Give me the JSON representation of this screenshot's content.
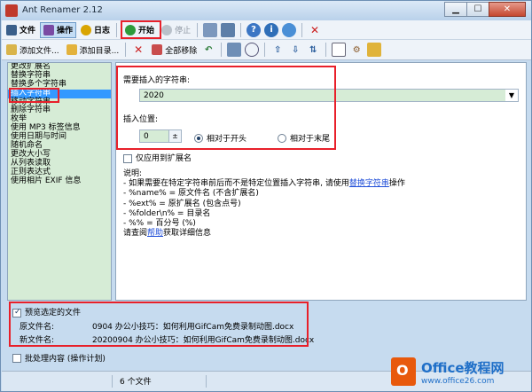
{
  "window": {
    "title": "Ant Renamer 2.12"
  },
  "menu": [
    {
      "label": "文件"
    },
    {
      "label": "操作"
    },
    {
      "label": "日志"
    },
    {
      "label": "开始"
    },
    {
      "label": "停止"
    }
  ],
  "toolbar2": {
    "add_files": "添加文件...",
    "add_dir": "添加目录...",
    "remove_all": "全部移除"
  },
  "actions": [
    "更改扩展名",
    "替换字符串",
    "替换多个字符串",
    "插入字符串",
    "移动字符串",
    "删除字符串",
    "枚举",
    "使用 MP3 标签信息",
    "使用日期与时间",
    "随机命名",
    "更改大小写",
    "从列表读取",
    "正则表达式",
    "使用相片 EXIF 信息"
  ],
  "form": {
    "insert_label": "需要插入的字符串:",
    "insert_value": "2020",
    "position_label": "插入位置:",
    "position_value": "0",
    "radio_start": "相对于开头",
    "radio_end": "相对于末尾",
    "ext_only": "仅应用到扩展名"
  },
  "description": {
    "title": "说明:",
    "line1_a": "- 如果需要在特定字符串前后而不是特定位置插入字符串, 请使用",
    "line1_link": "替换字符串",
    "line1_b": "操作",
    "line2": "- %name% = 原文件名 (不含扩展名)",
    "line3": "- %ext% = 原扩展名 (包含点号)",
    "line4": "- %folder\\n% = 目录名",
    "line5": "- %% = 百分号 (%)",
    "line6_a": "请查阅",
    "line6_link": "帮助",
    "line6_b": "获取详细信息"
  },
  "preview": {
    "checkbox": "预览选定的文件",
    "old_label": "原文件名:",
    "old_value": "0904   办公小技巧：如何利用GifCam免费录制动图.docx",
    "new_label": "新文件名:",
    "new_value": "20200904   办公小技巧：如何利用GifCam免费录制动图.docx"
  },
  "batch": {
    "label": "批处理内容 (操作计划)"
  },
  "status": {
    "file_count": "6 个文件"
  },
  "watermark": {
    "main": "Office教程网",
    "sub": "www.office26.com"
  },
  "colors": {
    "highlight": "#e8202a",
    "selection": "#3399ff",
    "panel_green": "#d6ecd6"
  }
}
